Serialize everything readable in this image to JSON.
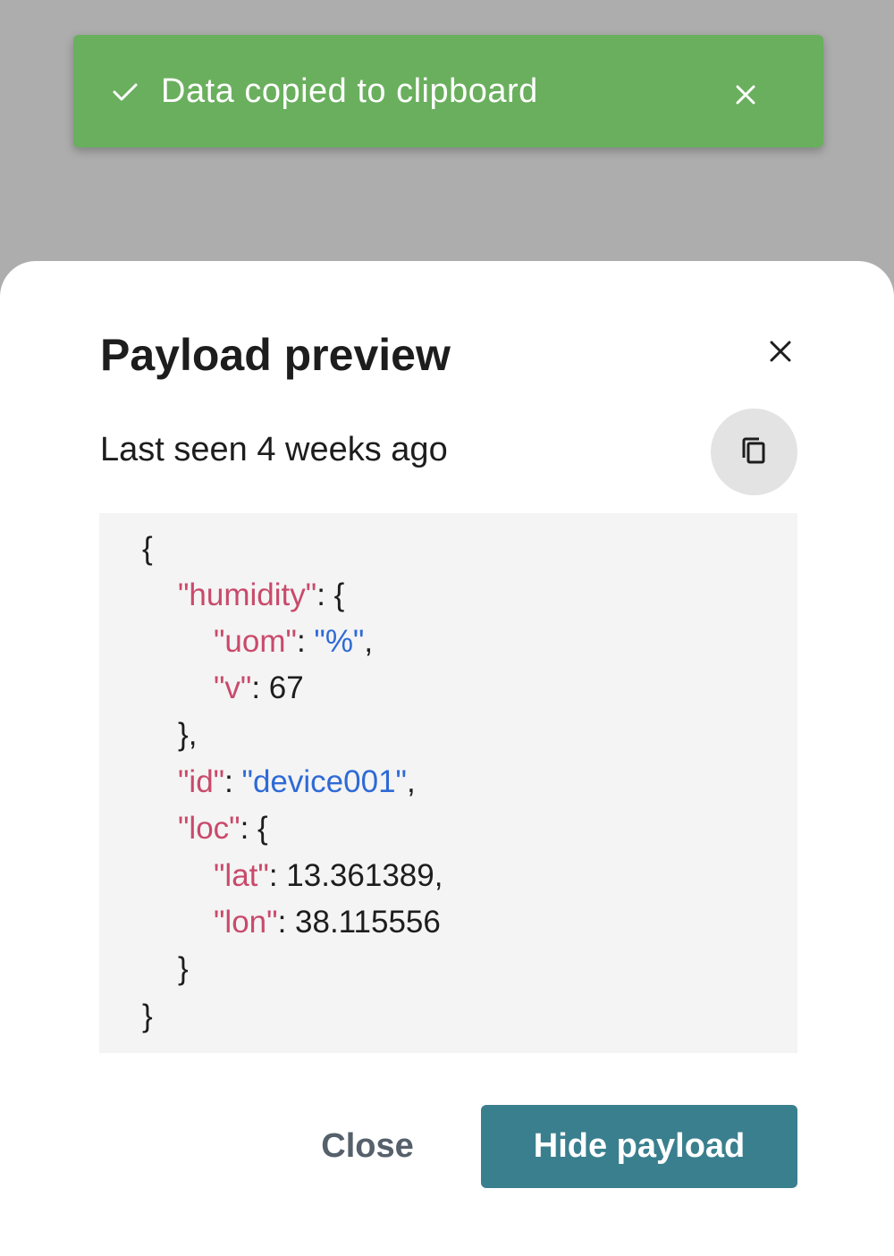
{
  "toast": {
    "message": "Data copied to clipboard",
    "check_icon": "check-icon",
    "close_icon": "close-icon",
    "background": "#6aaf5e"
  },
  "modal": {
    "title": "Payload preview",
    "subtitle": "Last seen 4 weeks ago",
    "close_icon": "close-icon",
    "copy_icon": "copy-icon",
    "payload": {
      "humidity": {
        "uom": "%",
        "v": 67
      },
      "id": "device001",
      "loc": {
        "lat": 13.361389,
        "lon": 38.115556
      }
    },
    "code_lines": [
      [
        {
          "t": "{",
          "c": "p"
        }
      ],
      [
        {
          "t": "\"humidity\"",
          "c": "k"
        },
        {
          "t": ": {",
          "c": "p"
        }
      ],
      [
        {
          "t": "\"uom\"",
          "c": "k"
        },
        {
          "t": ": ",
          "c": "p"
        },
        {
          "t": "\"%\"",
          "c": "s"
        },
        {
          "t": ",",
          "c": "p"
        }
      ],
      [
        {
          "t": "\"v\"",
          "c": "k"
        },
        {
          "t": ": 67",
          "c": "p"
        }
      ],
      [
        {
          "t": "},",
          "c": "p"
        }
      ],
      [
        {
          "t": "\"id\"",
          "c": "k"
        },
        {
          "t": ": ",
          "c": "p"
        },
        {
          "t": "\"device001\"",
          "c": "s"
        },
        {
          "t": ",",
          "c": "p"
        }
      ],
      [
        {
          "t": "\"loc\"",
          "c": "k"
        },
        {
          "t": ": {",
          "c": "p"
        }
      ],
      [
        {
          "t": "\"lat\"",
          "c": "k"
        },
        {
          "t": ": 13.361389,",
          "c": "p"
        }
      ],
      [
        {
          "t": "\"lon\"",
          "c": "k"
        },
        {
          "t": ": 38.115556",
          "c": "p"
        }
      ],
      [
        {
          "t": "}",
          "c": "p"
        }
      ],
      [
        {
          "t": "}",
          "c": "p"
        }
      ]
    ],
    "buttons": {
      "close_label": "Close",
      "hide_label": "Hide payload"
    },
    "colors": {
      "key": "#c94a6b",
      "string": "#2f6ad6",
      "primary_button": "#3a7f8e"
    }
  }
}
